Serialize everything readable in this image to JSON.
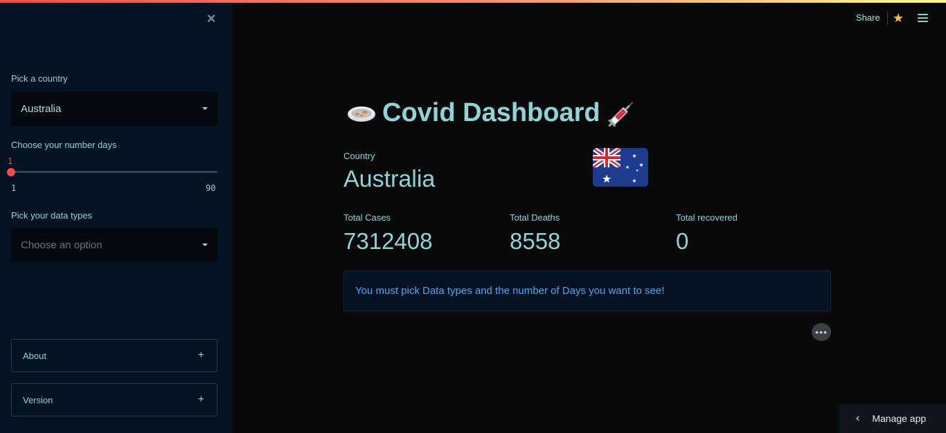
{
  "sidebar": {
    "country_label": "Pick a country",
    "country_value": "Australia",
    "days_label": "Choose your number days",
    "days_value": "1",
    "days_min": "1",
    "days_max": "90",
    "datatypes_label": "Pick your data types",
    "datatypes_placeholder": "Choose an option",
    "expanders": [
      {
        "label": "About"
      },
      {
        "label": "Version"
      }
    ]
  },
  "header": {
    "share_label": "Share"
  },
  "main": {
    "title": "Covid Dashboard",
    "country_label": "Country",
    "country_value": "Australia",
    "metrics": [
      {
        "label": "Total Cases",
        "value": "7312408"
      },
      {
        "label": "Total Deaths",
        "value": "8558"
      },
      {
        "label": "Total recovered",
        "value": "0"
      }
    ],
    "info_message": "You must pick Data types and the number of Days you want to see!"
  },
  "footer": {
    "manage_label": "Manage app"
  },
  "colors": {
    "accent": "#ff4b4b",
    "text": "#8fd3d9",
    "info": "#4ea7f5",
    "sidebar_bg": "#031324",
    "main_bg": "#0a0a0b"
  }
}
